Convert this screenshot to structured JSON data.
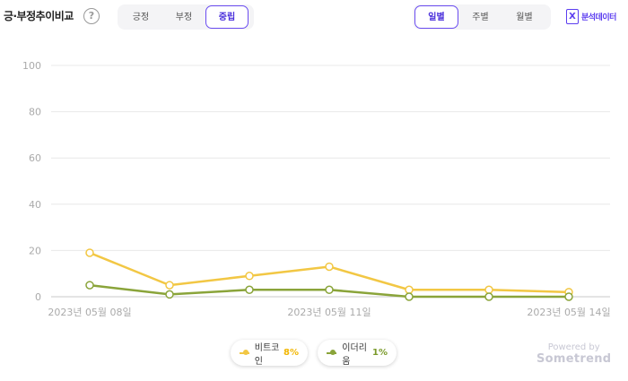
{
  "header": {
    "title": "긍·부정추이비교",
    "help_icon": "?",
    "sentiment_tabs": [
      "긍정",
      "부정",
      "중립"
    ],
    "sentiment_selected": "중립",
    "period_tabs": [
      "일별",
      "주별",
      "월별"
    ],
    "period_selected": "일별",
    "analysis_label": "분석데이터",
    "analysis_icon": "excel-icon"
  },
  "chart_data": {
    "type": "line",
    "x": [
      "2023년 05월 08일",
      "2023년 05월 09일",
      "2023년 05월 10일",
      "2023년 05월 11일",
      "2023년 05월 12일",
      "2023년 05월 13일",
      "2023년 05월 14일"
    ],
    "x_tick_labels": [
      "2023년 05월 08일",
      "2023년 05월 11일",
      "2023년 05월 14일"
    ],
    "y_ticks": [
      0,
      20,
      40,
      60,
      80,
      100
    ],
    "ylim": [
      0,
      100
    ],
    "grid": true,
    "legend_position": "bottom",
    "series": [
      {
        "name": "비트코인",
        "share": "8%",
        "color": "#f2c744",
        "values": [
          19,
          5,
          9,
          13,
          3,
          3,
          2
        ]
      },
      {
        "name": "이더리움",
        "share": "1%",
        "color": "#8aa43a",
        "values": [
          5,
          1,
          3,
          3,
          0,
          0,
          0
        ]
      }
    ]
  },
  "footer": {
    "powered_by": "Powered by",
    "brand": "Sometrend"
  }
}
